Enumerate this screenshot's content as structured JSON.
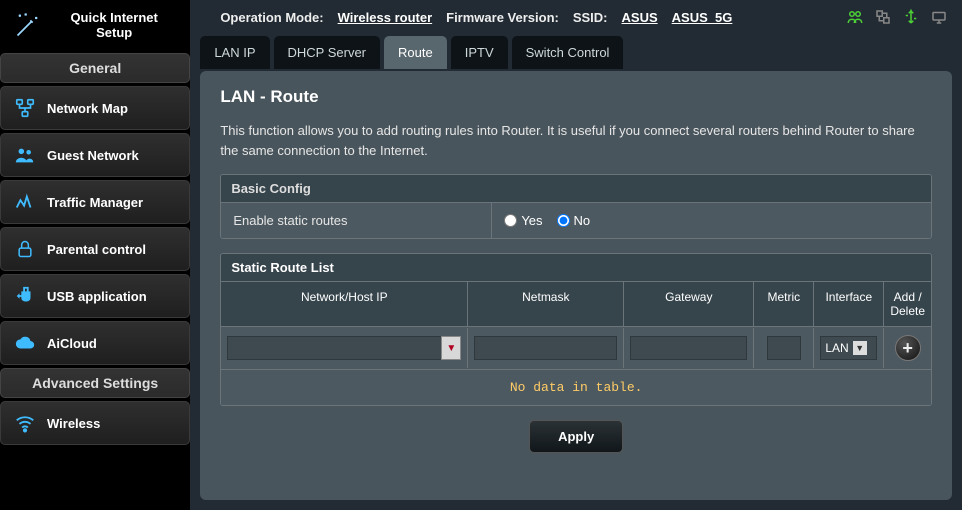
{
  "quick_setup": "Quick Internet Setup",
  "sidebar": {
    "general_title": "General",
    "items": [
      {
        "label": "Network Map"
      },
      {
        "label": "Guest Network"
      },
      {
        "label": "Traffic Manager"
      },
      {
        "label": "Parental control"
      },
      {
        "label": "USB application"
      },
      {
        "label": "AiCloud"
      }
    ],
    "advanced_title": "Advanced Settings",
    "adv_items": [
      {
        "label": "Wireless"
      }
    ]
  },
  "topbar": {
    "op_mode_label": "Operation Mode:",
    "op_mode_value": "Wireless router",
    "fw_label": "Firmware Version:",
    "ssid_label": "SSID:",
    "ssid1": "ASUS",
    "ssid2": "ASUS_5G"
  },
  "tabs": [
    "LAN IP",
    "DHCP Server",
    "Route",
    "IPTV",
    "Switch Control"
  ],
  "active_tab": 2,
  "page": {
    "title": "LAN - Route",
    "desc": "This function allows you to add routing rules into Router. It is useful if you connect several routers behind Router to share the same connection to the Internet."
  },
  "basic": {
    "header": "Basic Config",
    "label": "Enable static routes",
    "yes": "Yes",
    "no": "No",
    "value": "No"
  },
  "table": {
    "header": "Static Route List",
    "cols": {
      "net": "Network/Host IP",
      "mask": "Netmask",
      "gw": "Gateway",
      "met": "Metric",
      "if": "Interface",
      "ad": "Add / Delete"
    },
    "if_value": "LAN",
    "nodata": "No data in table."
  },
  "apply_label": "Apply"
}
